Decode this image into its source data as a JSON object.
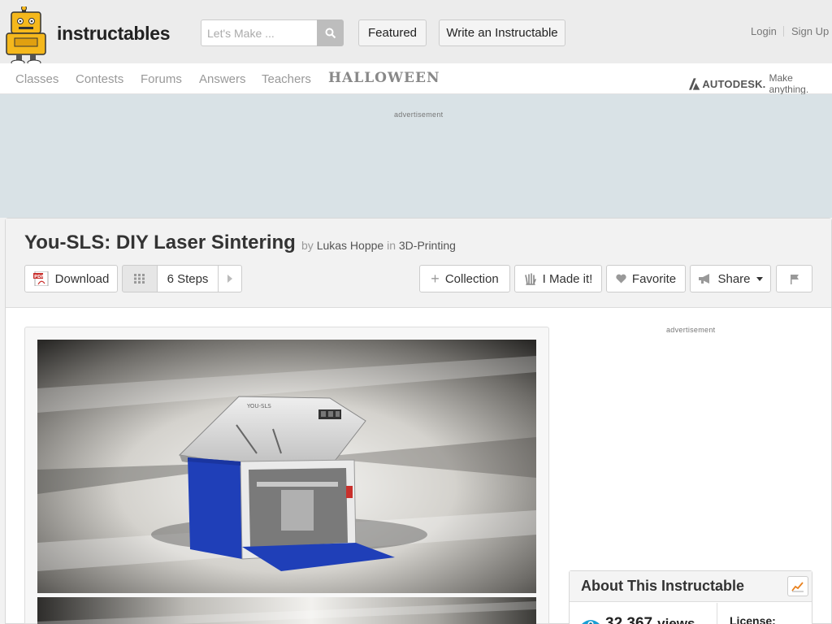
{
  "header": {
    "logo_text": "instructables",
    "search_placeholder": "Let's Make ...",
    "featured_label": "Featured",
    "write_label": "Write an Instructable",
    "login_label": "Login",
    "signup_label": "Sign Up",
    "brand_color": "#f5b81c"
  },
  "nav": {
    "items": [
      "Classes",
      "Contests",
      "Forums",
      "Answers",
      "Teachers"
    ],
    "halloween": "HALLOWEEN",
    "autodesk_word": "AUTODESK.",
    "autodesk_tag": "Make anything."
  },
  "ads": {
    "top_label": "advertisement",
    "side_label": "advertisement"
  },
  "project": {
    "title": "You-SLS: DIY Laser Sintering",
    "by": "by",
    "author": "Lukas Hoppe",
    "in": "in",
    "category": "3D-Printing"
  },
  "actions": {
    "download": "Download",
    "steps": "6 Steps",
    "collection": "Collection",
    "made_it": "I Made it!",
    "favorite": "Favorite",
    "share": "Share"
  },
  "images": {
    "machine_label": "YOU-SLS"
  },
  "about": {
    "title": "About This Instructable",
    "views_count": "32,367",
    "views_word": "views",
    "license_label": "License:"
  },
  "colors": {
    "machine_blue": "#1f3fb8",
    "ad_band": "#d9e2e6"
  }
}
